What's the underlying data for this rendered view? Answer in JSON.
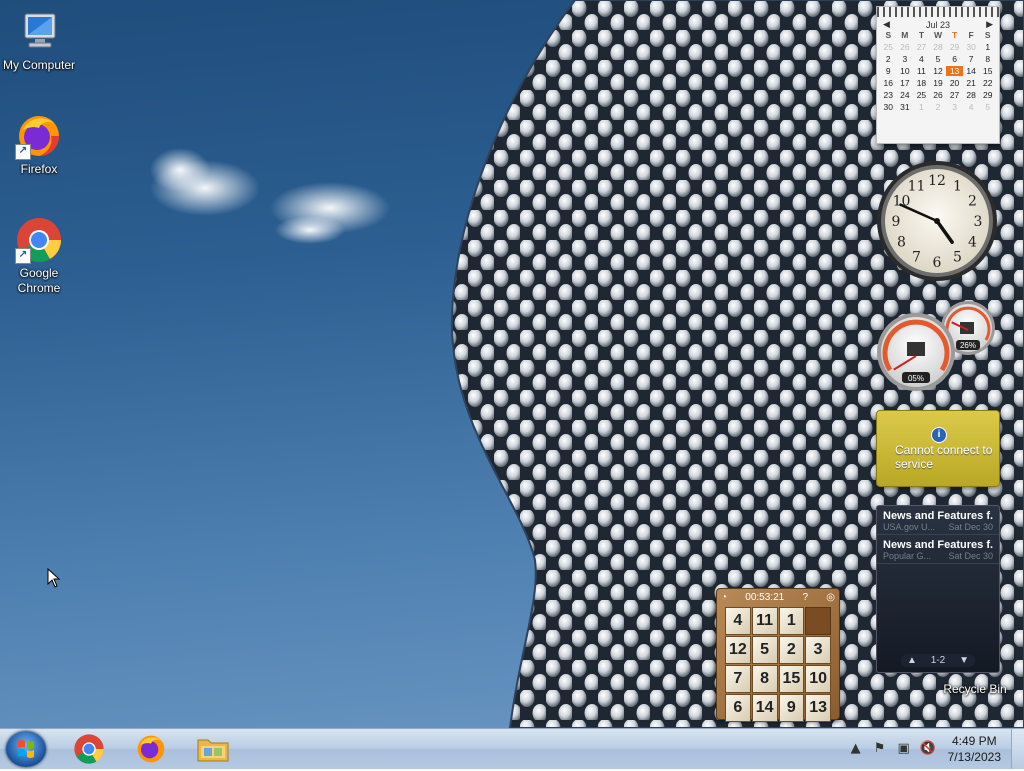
{
  "desktop": {
    "icons": [
      {
        "label": "My Computer",
        "icon": "computer-icon"
      },
      {
        "label": "Firefox",
        "icon": "firefox-icon"
      },
      {
        "label": "Google Chrome",
        "icon": "chrome-icon"
      },
      {
        "label": "Recycle Bin",
        "icon": "recycle-bin-icon"
      }
    ]
  },
  "gadgets": {
    "calendar": {
      "month_label": "Jul 23",
      "weekdays": [
        "S",
        "M",
        "T",
        "W",
        "T",
        "F",
        "S"
      ],
      "today_weekday_index": 4,
      "days": [
        {
          "d": "25",
          "out": true
        },
        {
          "d": "26",
          "out": true
        },
        {
          "d": "27",
          "out": true
        },
        {
          "d": "28",
          "out": true
        },
        {
          "d": "29",
          "out": true
        },
        {
          "d": "30",
          "out": true
        },
        {
          "d": "1"
        },
        {
          "d": "2"
        },
        {
          "d": "3"
        },
        {
          "d": "4"
        },
        {
          "d": "5"
        },
        {
          "d": "6"
        },
        {
          "d": "7"
        },
        {
          "d": "8"
        },
        {
          "d": "9"
        },
        {
          "d": "10"
        },
        {
          "d": "11"
        },
        {
          "d": "12"
        },
        {
          "d": "13",
          "today": true
        },
        {
          "d": "14"
        },
        {
          "d": "15"
        },
        {
          "d": "16"
        },
        {
          "d": "17"
        },
        {
          "d": "18"
        },
        {
          "d": "19"
        },
        {
          "d": "20"
        },
        {
          "d": "21"
        },
        {
          "d": "22"
        },
        {
          "d": "23"
        },
        {
          "d": "24"
        },
        {
          "d": "25"
        },
        {
          "d": "26"
        },
        {
          "d": "27"
        },
        {
          "d": "28"
        },
        {
          "d": "29"
        },
        {
          "d": "30"
        },
        {
          "d": "31"
        },
        {
          "d": "1",
          "out": true
        },
        {
          "d": "2",
          "out": true
        },
        {
          "d": "3",
          "out": true
        },
        {
          "d": "4",
          "out": true
        },
        {
          "d": "5",
          "out": true
        }
      ]
    },
    "clock": {
      "numerals": [
        "12",
        "1",
        "2",
        "3",
        "4",
        "5",
        "6",
        "7",
        "8",
        "9",
        "10",
        "11"
      ],
      "hour": 4,
      "minute": 49
    },
    "cpu_meter": {
      "cpu_percent": "05%",
      "memory_percent": "26%",
      "cpu_value": 5,
      "memory_value": 26
    },
    "weather": {
      "message": "Cannot connect to service",
      "info_glyph": "i"
    },
    "feeds": {
      "items": [
        {
          "title": "News and Features f...",
          "source": "USA.gov U...",
          "date": "Sat Dec 30"
        },
        {
          "title": "News and Features f...",
          "source": "Popular G...",
          "date": "Sat Dec 30"
        }
      ],
      "page": "1-2"
    },
    "puzzle": {
      "timer": "00:53:21",
      "tiles": [
        "4",
        "11",
        "1",
        "",
        "12",
        "5",
        "2",
        "3",
        "7",
        "8",
        "15",
        "10",
        "6",
        "14",
        "9",
        "13"
      ]
    }
  },
  "taskbar": {
    "pinned": [
      {
        "name": "chrome",
        "icon": "chrome-icon"
      },
      {
        "name": "firefox",
        "icon": "firefox-icon"
      },
      {
        "name": "explorer",
        "icon": "folder-icon"
      }
    ],
    "time": "4:49 PM",
    "date": "7/13/2023"
  },
  "colors": {
    "accent_orange": "#e8741c",
    "weather_yellow": "#c9b834",
    "taskbar_blue": "#b9cde4"
  }
}
